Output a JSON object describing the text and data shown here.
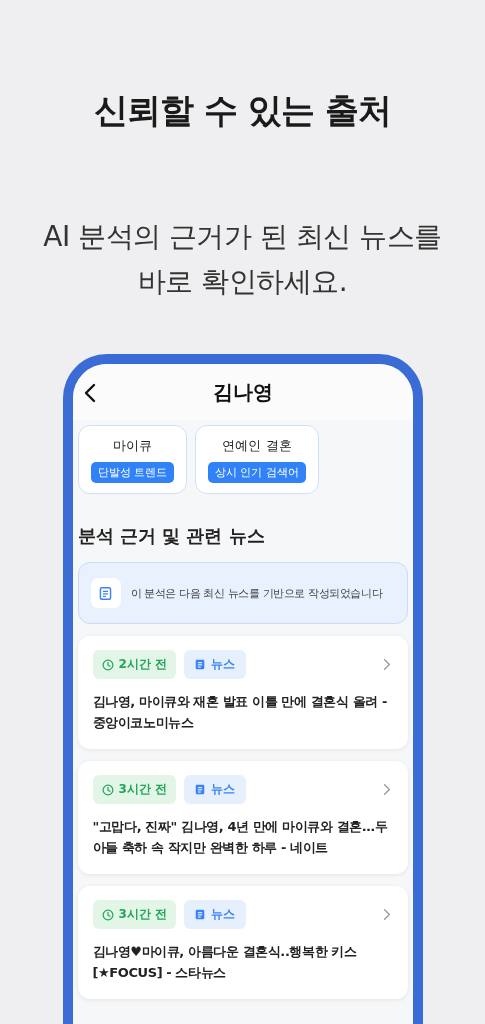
{
  "headline": "신뢰할 수 있는 출처",
  "subtitle": "AI 분석의 근거가 된 최신 뉴스를\n바로 확인하세요.",
  "phone": {
    "title": "김나영",
    "topics": [
      {
        "name": "마이큐",
        "tag": "단발성 트렌드"
      },
      {
        "name": "연예인 결혼",
        "tag": "상시 인기 검색어"
      }
    ],
    "section_title": "분석 근거 및 관련 뉴스",
    "notice": "이 분석은 다음 최신 뉴스를 기반으로 작성되었습니다",
    "news": [
      {
        "time": "2시간 전",
        "type": "뉴스",
        "headline": "김나영, 마이큐와 재혼 발표 이틀 만에 결혼식 올려 - 중앙이코노미뉴스"
      },
      {
        "time": "3시간 전",
        "type": "뉴스",
        "headline": "\"고맙다, 진짜\" 김나영, 4년 만에 마이큐와 결혼…두 아들 축하 속 작지만 완벽한 하루 - 네이트"
      },
      {
        "time": "3시간 전",
        "type": "뉴스",
        "headline": "김나영♥마이큐, 아름다운 결혼식..행복한 키스 [★FOCUS] - 스타뉴스"
      }
    ]
  }
}
